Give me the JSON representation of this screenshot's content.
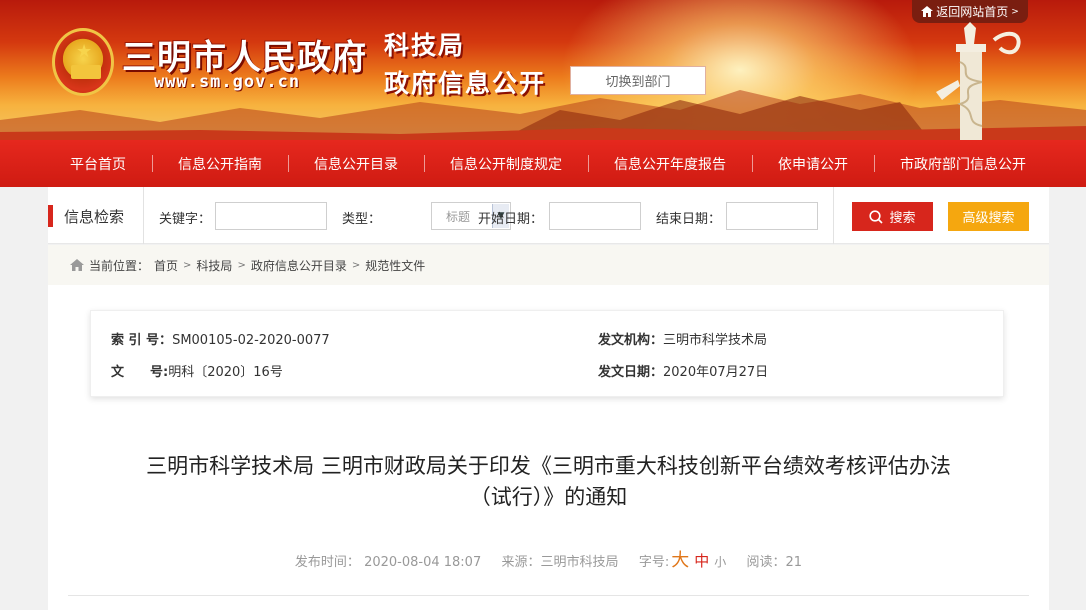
{
  "header": {
    "city_title": "三明市人民政府",
    "city_url": "www.sm.gov.cn",
    "dept_name": "科技局",
    "dept_sub": "政府信息公开",
    "switch_label": "切换到部门",
    "back_label": "返回网站首页"
  },
  "nav": {
    "items": [
      {
        "label": "平台首页"
      },
      {
        "label": "信息公开指南"
      },
      {
        "label": "信息公开目录"
      },
      {
        "label": "信息公开制度规定"
      },
      {
        "label": "信息公开年度报告"
      },
      {
        "label": "依申请公开"
      },
      {
        "label": "市政府部门信息公开"
      }
    ]
  },
  "search": {
    "title": "信息检索",
    "keyword_label": "关键字：",
    "keyword_value": "",
    "type_label": "类型：",
    "type_value": "标题",
    "start_label": "开始日期：",
    "start_value": "",
    "end_label": "结束日期：",
    "end_value": "",
    "search_btn": "搜索",
    "adv_btn": "高级搜索"
  },
  "breadcrumb": {
    "prefix": "当前位置：",
    "items": [
      "首页",
      "科技局",
      "政府信息公开目录",
      "规范性文件"
    ]
  },
  "meta": {
    "index_label": "索 引 号：",
    "index_value": "SM00105-02-2020-0077",
    "org_label": "发文机构：",
    "org_value": "三明市科学技术局",
    "docno_label": "文　　号:",
    "docno_value": "明科〔2020〕16号",
    "date_label": "发文日期：",
    "date_value": "2020年07月27日"
  },
  "article": {
    "title_line1": "三明市科学技术局 三明市财政局关于印发《三明市重大科技创新平台绩效考核评估办法",
    "title_line2": "（试行）》的通知",
    "publish_label": "发布时间：",
    "publish_time": "2020-08-04 18:07",
    "source_label": "来源：",
    "source_value": "三明市科技局",
    "fontsize_label": "字号:",
    "font_big": "大",
    "font_mid": "中",
    "font_small": "小",
    "read_label": "阅读：",
    "read_count": "21"
  }
}
